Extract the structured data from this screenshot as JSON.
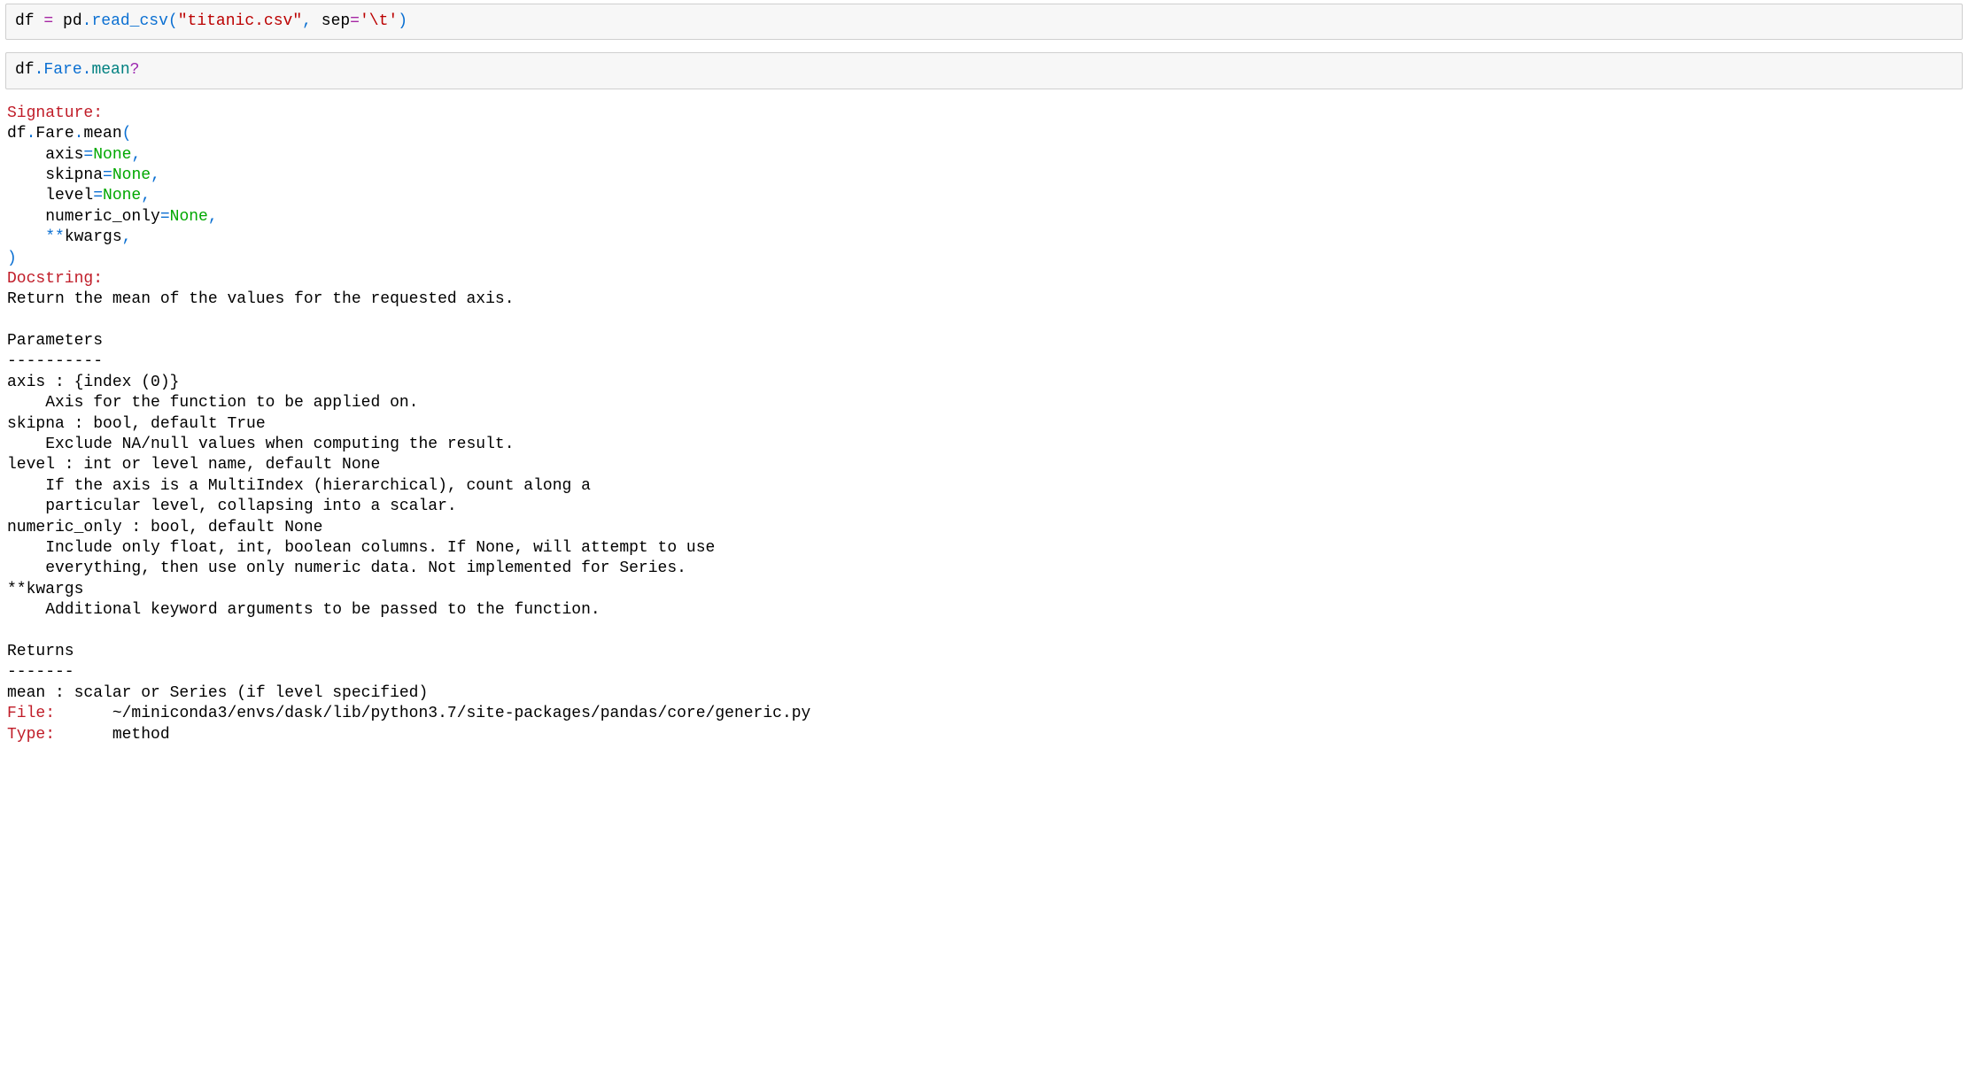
{
  "cell1": {
    "tokens": {
      "df": "df",
      "sp1": " ",
      "eq": "=",
      "sp2": " ",
      "pd": "pd",
      "dot1": ".",
      "read_csv": "read_csv",
      "lp": "(",
      "str": "\"titanic.csv\"",
      "comma": ",",
      "sp3": " ",
      "sep": "sep",
      "eq2": "=",
      "str2": "'\\t'",
      "rp": ")"
    }
  },
  "cell2": {
    "tokens": {
      "df": "df",
      "dot1": ".",
      "fare": "Fare",
      "dot2": ".",
      "mean": "mean",
      "q": "?"
    }
  },
  "output": {
    "sig_label": "Signature:",
    "sig_line1_a": "df",
    "sig_line1_dot1": ".",
    "sig_line1_b": "Fare",
    "sig_line1_dot2": ".",
    "sig_line1_c": "mean",
    "sig_line1_lp": "(",
    "sig_axis": "    axis",
    "sig_eq": "=",
    "sig_none": "None",
    "sig_comma": ",",
    "sig_skipna": "    skipna",
    "sig_level": "    level",
    "sig_numeric": "    numeric_only",
    "sig_stars": "    **",
    "sig_kwargs": "kwargs",
    "sig_kwargs_comma": ",",
    "sig_rp": ")",
    "doc_label": "Docstring:",
    "doc_body": "Return the mean of the values for the requested axis.\n\nParameters\n----------\naxis : {index (0)}\n    Axis for the function to be applied on.\nskipna : bool, default True\n    Exclude NA/null values when computing the result.\nlevel : int or level name, default None\n    If the axis is a MultiIndex (hierarchical), count along a\n    particular level, collapsing into a scalar.\nnumeric_only : bool, default None\n    Include only float, int, boolean columns. If None, will attempt to use\n    everything, then use only numeric data. Not implemented for Series.\n**kwargs\n    Additional keyword arguments to be passed to the function.\n\nReturns\n-------\nmean : scalar or Series (if level specified)",
    "file_label": "File:",
    "file_value": "      ~/miniconda3/envs/dask/lib/python3.7/site-packages/pandas/core/generic.py",
    "type_label": "Type:",
    "type_value": "      method"
  }
}
